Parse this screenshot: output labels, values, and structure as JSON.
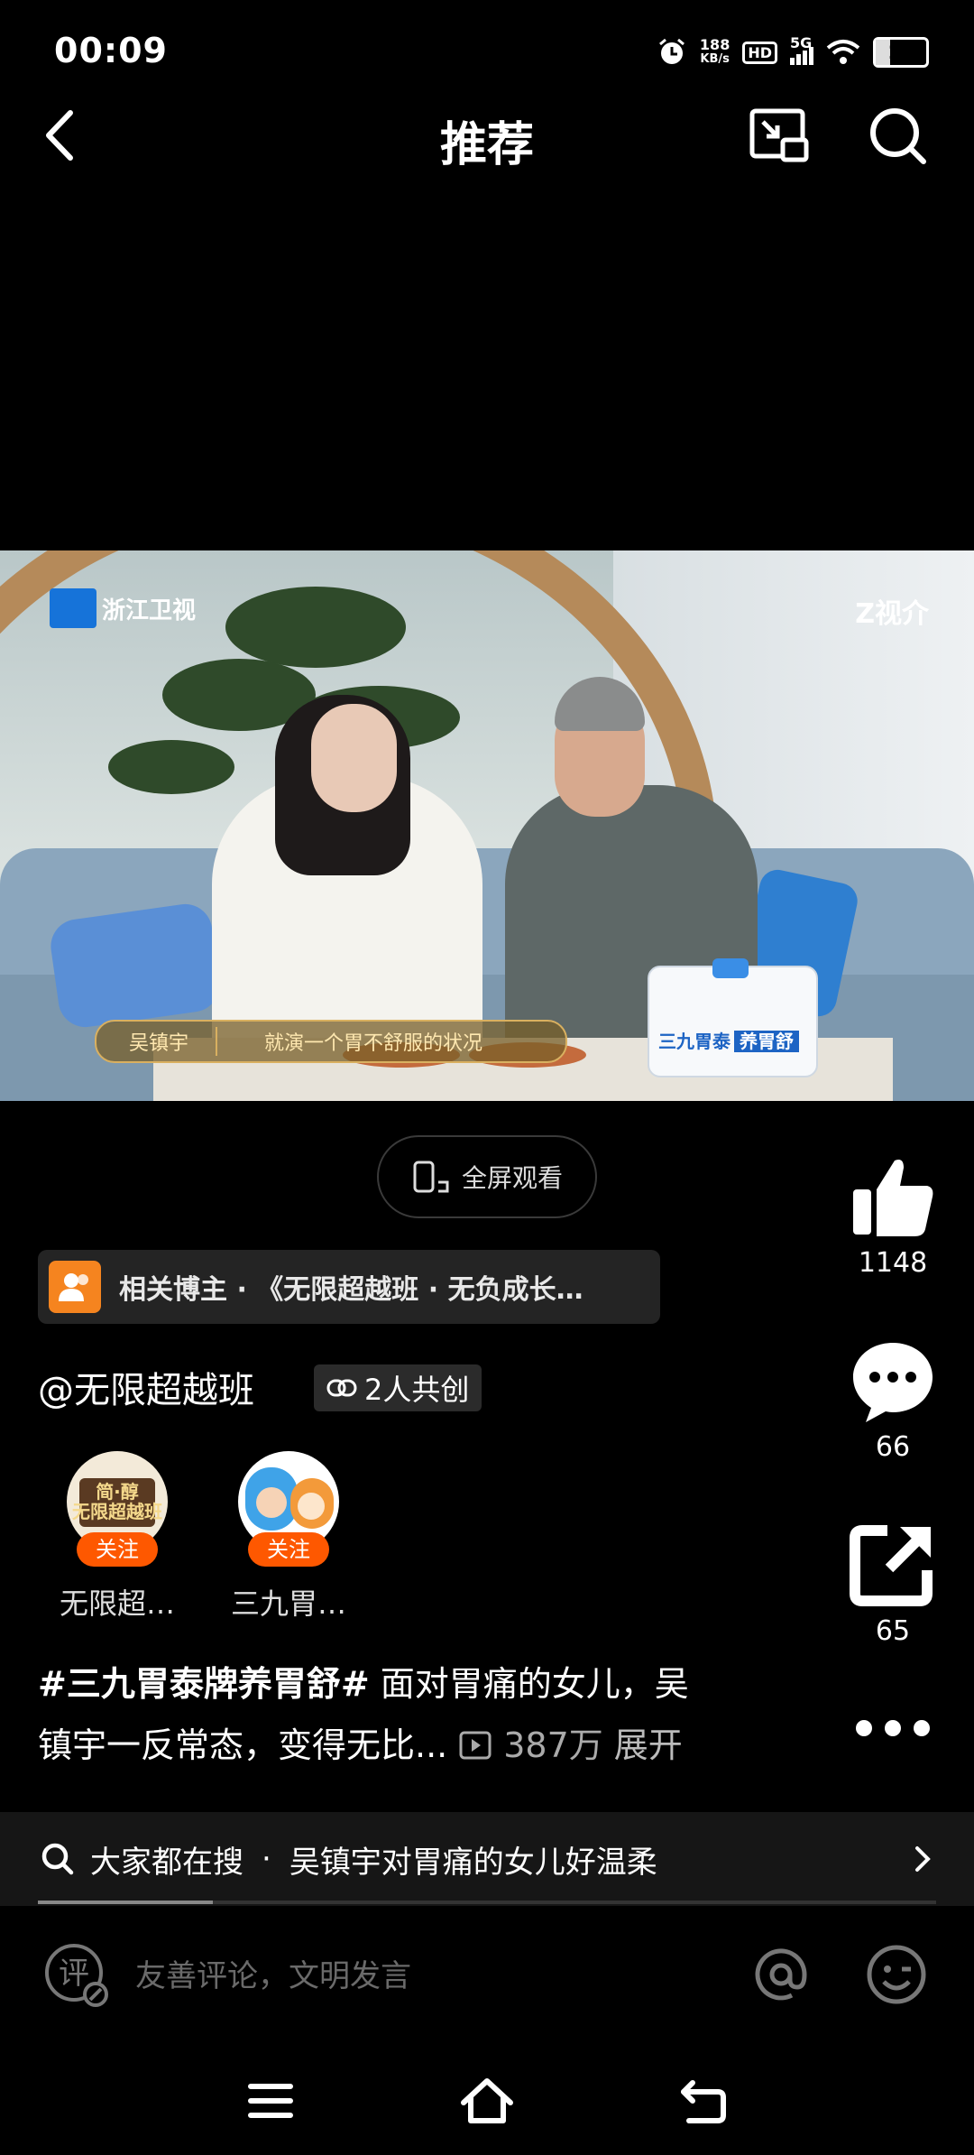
{
  "status_bar": {
    "time": "00:09",
    "speed_value": "188",
    "speed_unit": "KB/s",
    "hd": "HD",
    "network": "5G",
    "battery": "21"
  },
  "header": {
    "title": "推荐"
  },
  "video": {
    "channel_logo": "浙江卫视",
    "watermark": "Z视介",
    "subtitle_speaker": "吴镇宇",
    "subtitle_text": "就演一个胃不舒服的状况",
    "product_label_1": "三九胃泰",
    "product_label_2": "养胃舒"
  },
  "fullscreen": {
    "label": "全屏观看"
  },
  "actions": {
    "likes": "1148",
    "comments": "66",
    "shares": "65"
  },
  "related": {
    "text": "相关博主 · 《无限超越班 · 无负成长…"
  },
  "author": {
    "name": "@无限超越班",
    "cocreate": "2人共创"
  },
  "creators": [
    {
      "name": "无限超…",
      "follow": "关注",
      "avatar_text": "简·醇\n无限超越班"
    },
    {
      "name": "三九胃…",
      "follow": "关注"
    }
  ],
  "description": {
    "hashtag": "#三九胃泰牌养胃舒#",
    "text_line1": " 面对胃痛的女儿，吴",
    "text_line2": "镇宇一反常态，变得无比...",
    "views": "387万",
    "expand": "展开"
  },
  "search_suggest": {
    "prefix": "大家都在搜",
    "dot": "·",
    "query": "吴镇宇对胃痛的女儿好温柔"
  },
  "comment": {
    "placeholder": "友善评论，文明发言",
    "comment_icon_char": "评"
  },
  "colors": {
    "accent_orange": "#fe5800",
    "background": "#000000"
  }
}
